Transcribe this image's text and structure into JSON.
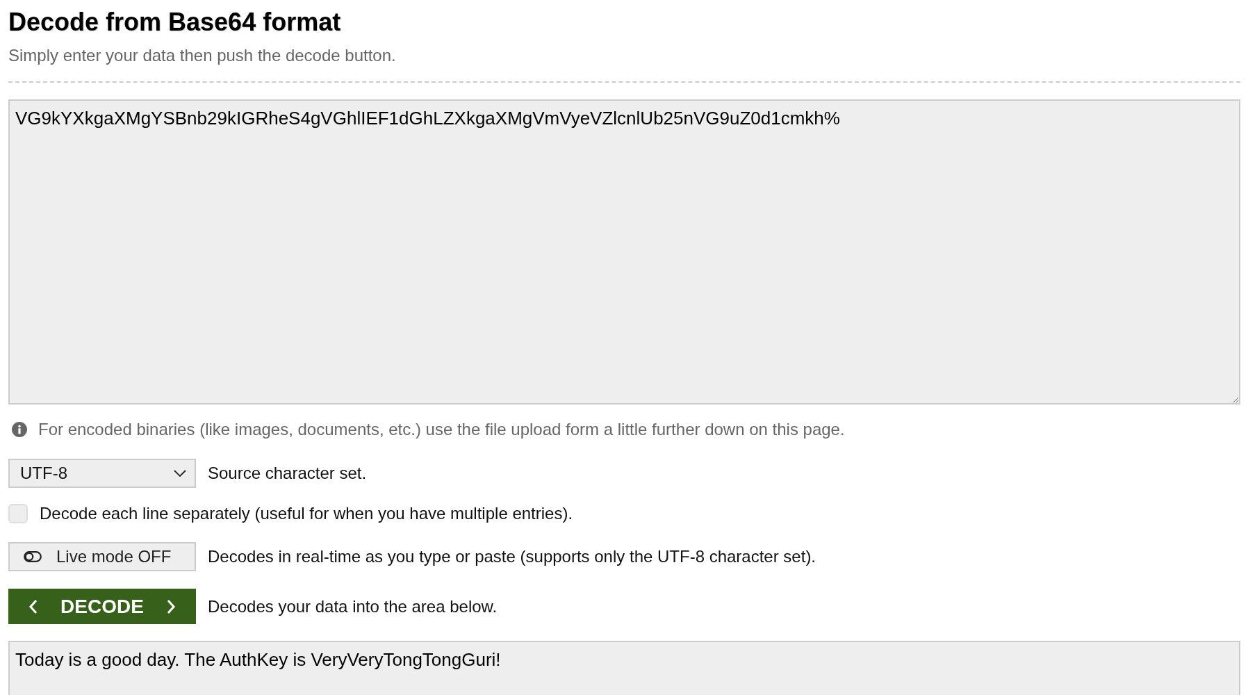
{
  "header": {
    "title": "Decode from Base64 format",
    "subtitle": "Simply enter your data then push the decode button."
  },
  "input": {
    "value": "VG9kYXkgaXMgYSBnb29kIGRheS4gVGhlIEF1dGhLZXkgaXMgVmVyeVZlcnlUb25nVG9uZ0d1cmkh%"
  },
  "info_note": {
    "text": "For encoded binaries (like images, documents, etc.) use the file upload form a little further down on this page."
  },
  "charset": {
    "value": "UTF-8",
    "label": "Source character set."
  },
  "line_by_line": {
    "label": "Decode each line separately (useful for when you have multiple entries).",
    "checked": false
  },
  "live_mode": {
    "label": "Live mode OFF",
    "on": false,
    "description": "Decodes in real-time as you type or paste (supports only the UTF-8 character set)."
  },
  "decode_button": {
    "label": "DECODE",
    "description": "Decodes your data into the area below."
  },
  "output": {
    "value": "Today is a good day. The AuthKey is VeryVeryTongTongGuri!"
  }
}
